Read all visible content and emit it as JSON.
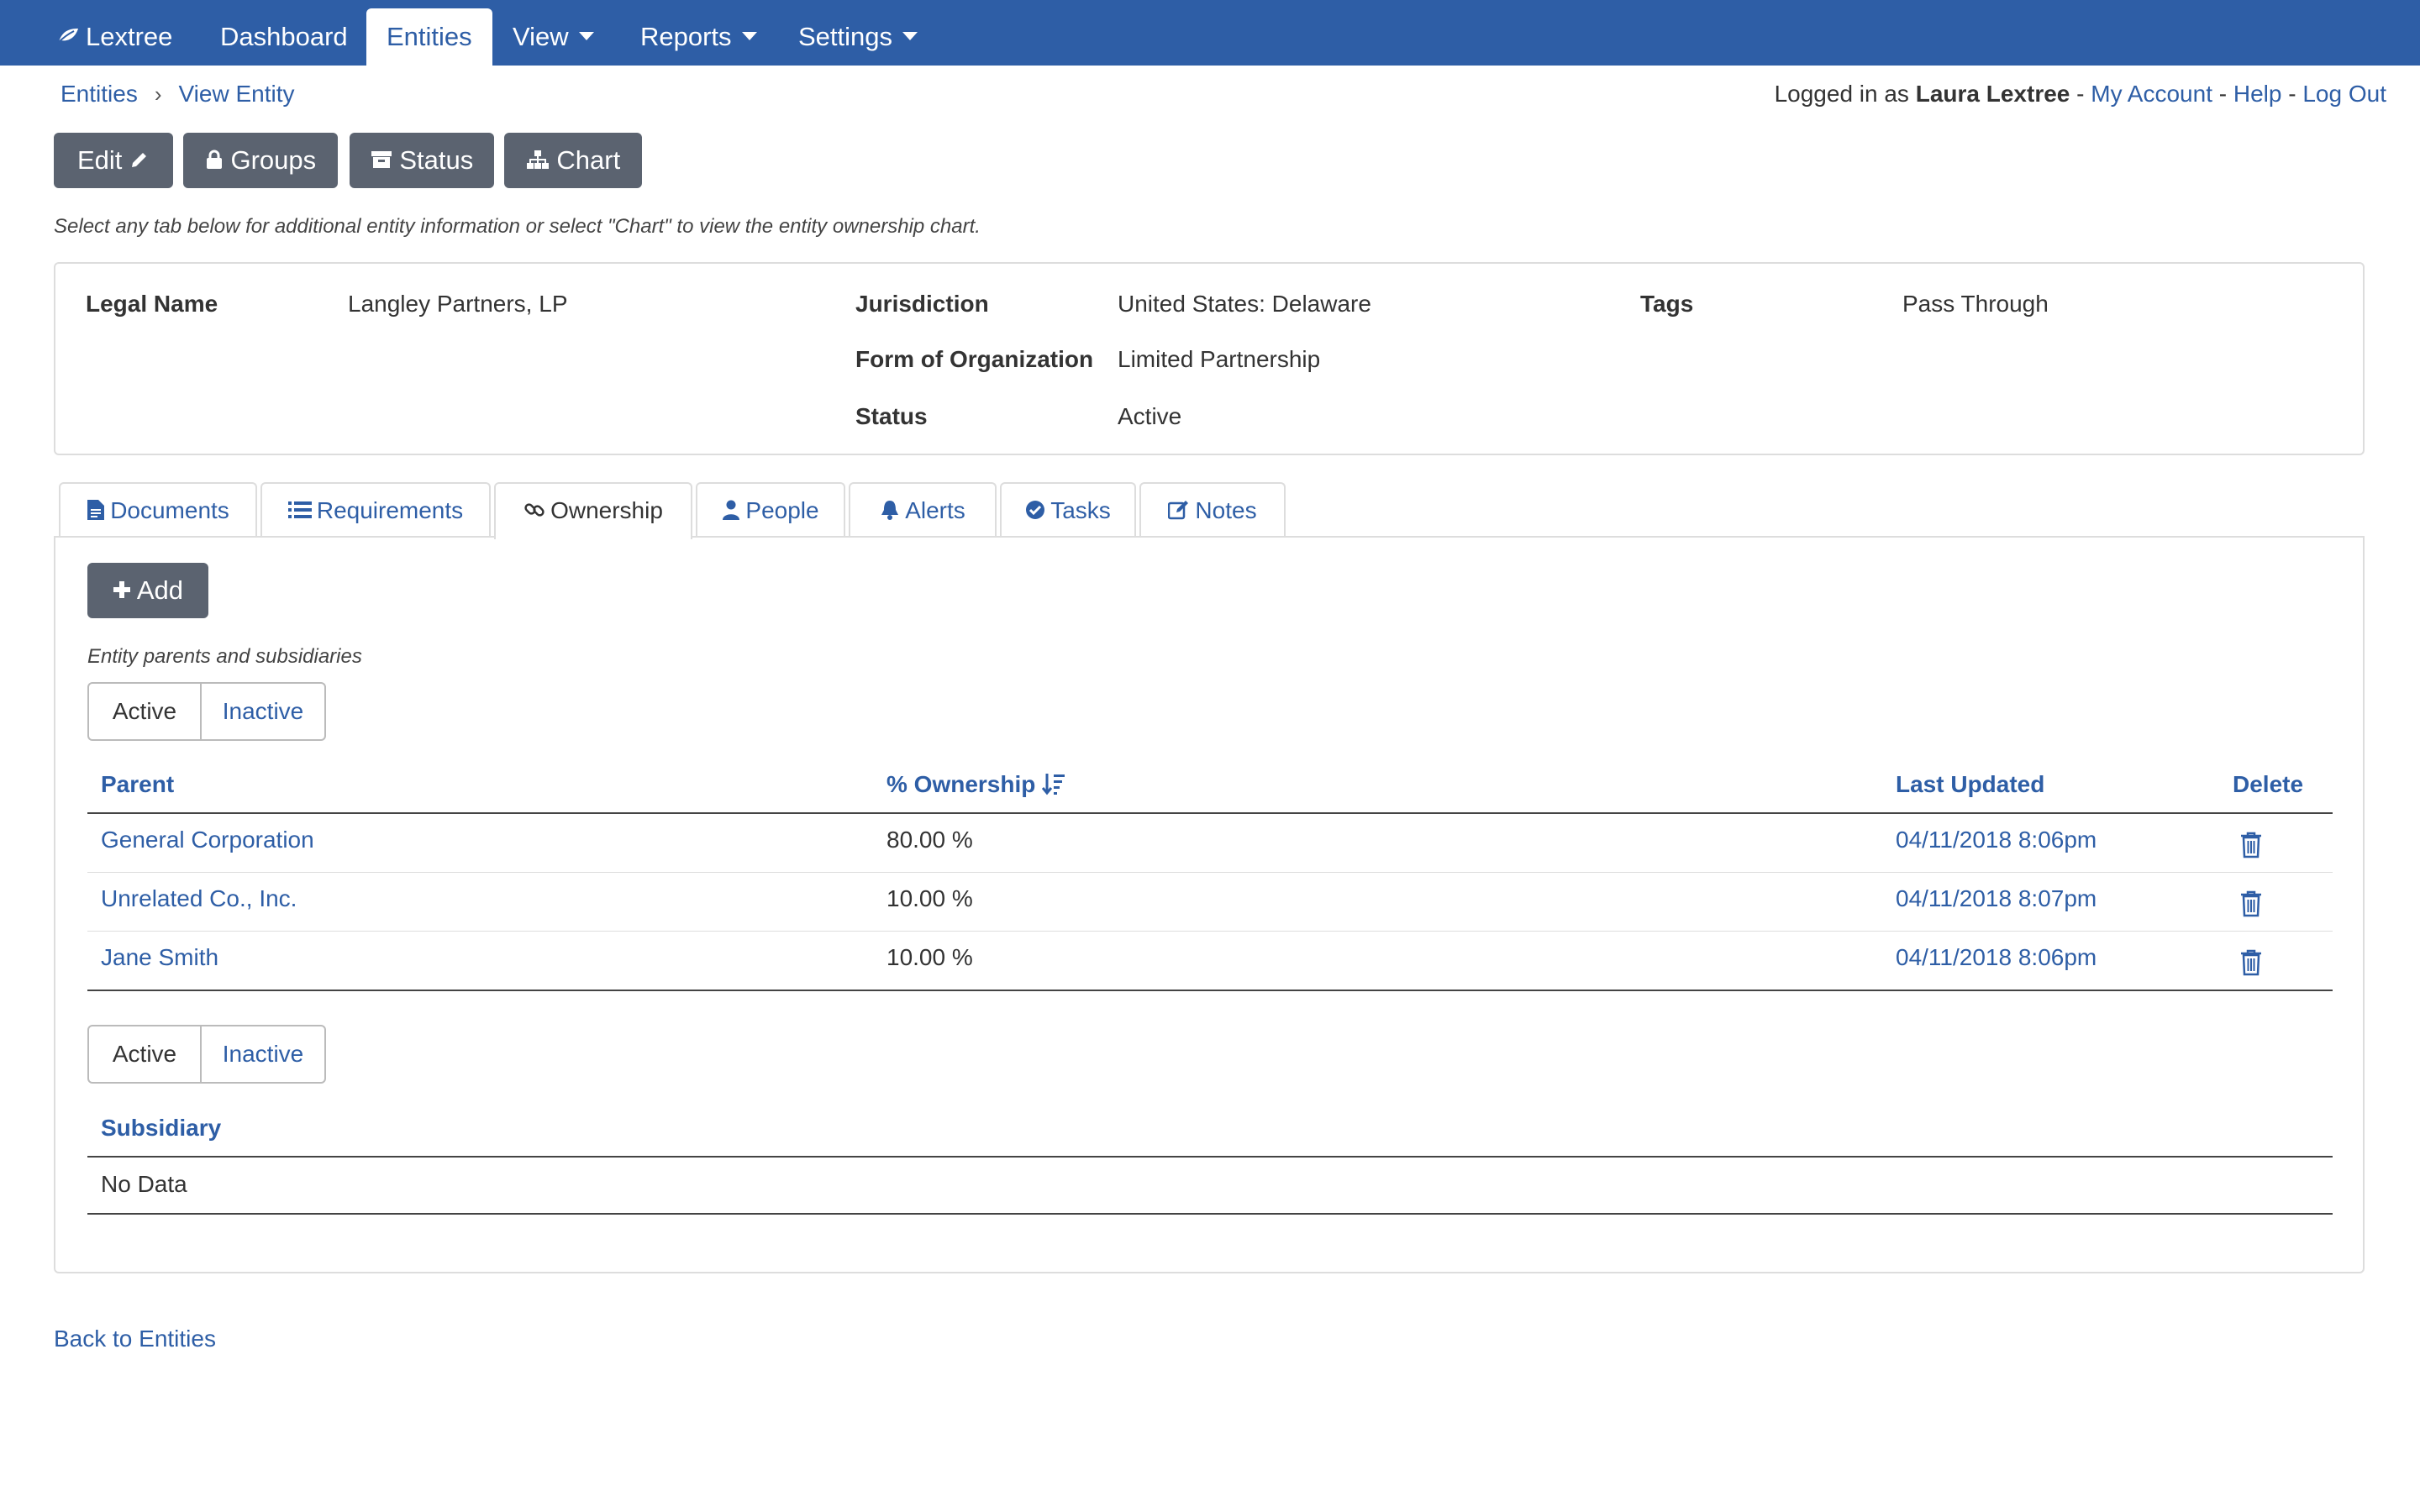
{
  "navbar": {
    "brand": "Lextree",
    "items": [
      {
        "label": "Dashboard"
      },
      {
        "label": "Entities"
      },
      {
        "label": "View"
      },
      {
        "label": "Reports"
      },
      {
        "label": "Settings"
      }
    ]
  },
  "breadcrumb": [
    "Entities",
    "View Entity"
  ],
  "user": {
    "prefix": "Logged in as",
    "name": "Laura Lextree",
    "sep": "-",
    "my_account": "My Account",
    "help": "Help",
    "logout": "Log Out"
  },
  "toolbar": {
    "edit": "Edit",
    "groups": "Groups",
    "status": "Status",
    "chart": "Chart"
  },
  "hint": "Select any tab below for additional entity information or select \"Chart\" to view the entity ownership chart.",
  "entity": {
    "legal_name_label": "Legal Name",
    "legal_name": "Langley Partners, LP",
    "jurisdiction_label": "Jurisdiction",
    "jurisdiction": "United States: Delaware",
    "form_label": "Form of Organization",
    "form": "Limited Partnership",
    "status_label": "Status",
    "status": "Active",
    "tags_label": "Tags",
    "tags": "Pass Through"
  },
  "tabs": [
    "Documents",
    "Requirements",
    "Ownership",
    "People",
    "Alerts",
    "Tasks",
    "Notes"
  ],
  "ownership": {
    "add_label": "Add",
    "subhint": "Entity parents and subsidiaries",
    "toggle_active": "Active",
    "toggle_inactive": "Inactive",
    "parents_headers": {
      "parent": "Parent",
      "ownership": "% Ownership",
      "updated": "Last Updated",
      "delete": "Delete"
    },
    "parents": [
      {
        "name": "General Corporation",
        "pct": "80.00 %",
        "updated": "04/11/2018 8:06pm"
      },
      {
        "name": "Unrelated Co., Inc.",
        "pct": "10.00 %",
        "updated": "04/11/2018 8:07pm"
      },
      {
        "name": "Jane Smith",
        "pct": "10.00 %",
        "updated": "04/11/2018 8:06pm"
      }
    ],
    "subsidiary_header": "Subsidiary",
    "subsidiary_empty": "No Data"
  },
  "back_link": "Back to Entities",
  "colors": {
    "primary": "#2e5ea6",
    "button": "#5b6370",
    "border": "#dddddd"
  }
}
